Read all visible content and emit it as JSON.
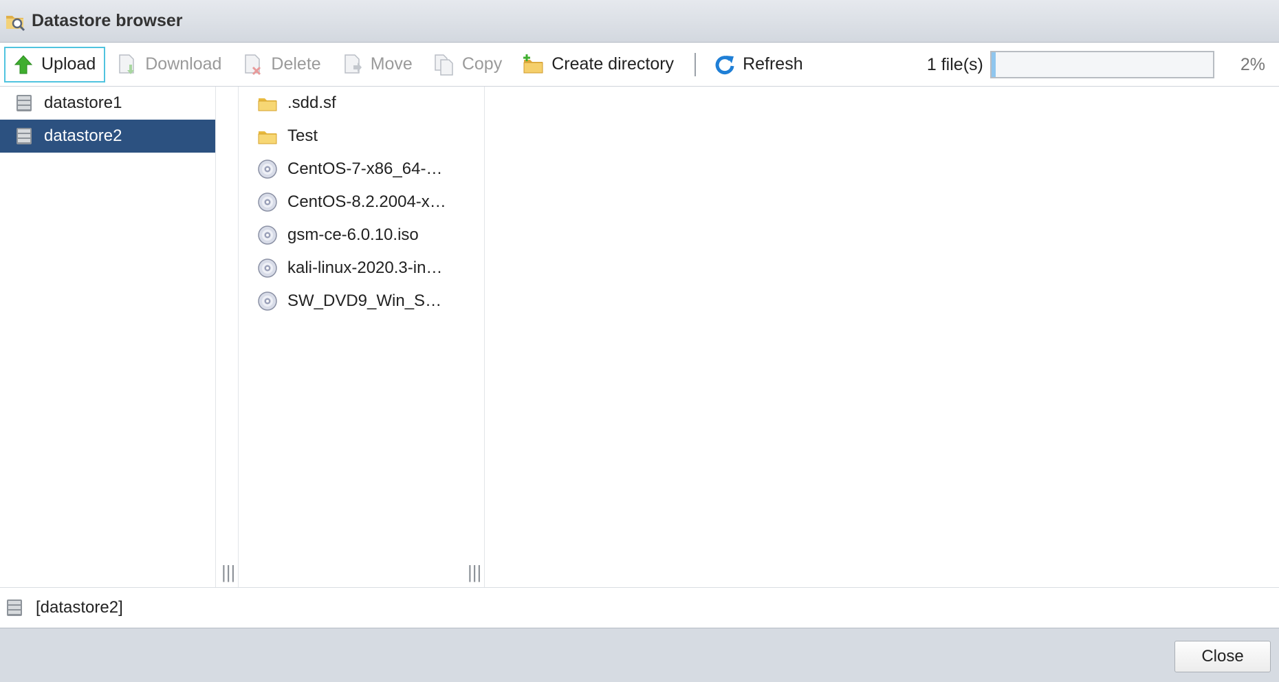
{
  "window": {
    "title": "Datastore browser",
    "icon": "datastore-browser-icon"
  },
  "toolbar": {
    "buttons": [
      {
        "label": "Upload",
        "icon": "upload-arrow-icon",
        "enabled": true
      },
      {
        "label": "Download",
        "icon": "download-icon",
        "enabled": false
      },
      {
        "label": "Delete",
        "icon": "delete-icon",
        "enabled": false
      },
      {
        "label": "Move",
        "icon": "move-icon",
        "enabled": false
      },
      {
        "label": "Copy",
        "icon": "copy-icon",
        "enabled": false
      },
      {
        "label": "Create directory",
        "icon": "create-folder-icon",
        "enabled": true
      },
      {
        "label": "Refresh",
        "icon": "refresh-icon",
        "enabled": true
      }
    ],
    "files_count": "1 file(s)",
    "progress_value": 0.02,
    "progress_text": "2%"
  },
  "datastores": [
    {
      "label": "datastore1",
      "selected": false
    },
    {
      "label": "datastore2",
      "selected": true
    }
  ],
  "files": [
    {
      "label": ".sdd.sf",
      "type": "folder"
    },
    {
      "label": "Test",
      "type": "folder"
    },
    {
      "label": "CentOS-7-x86_64-…",
      "type": "iso"
    },
    {
      "label": "CentOS-8.2.2004-x…",
      "type": "iso"
    },
    {
      "label": "gsm-ce-6.0.10.iso",
      "type": "iso"
    },
    {
      "label": "kali-linux-2020.3-in…",
      "type": "iso"
    },
    {
      "label": "SW_DVD9_Win_Sv…",
      "type": "iso"
    }
  ],
  "path": "[datastore2]",
  "footer": {
    "close_label": "Close"
  },
  "colors": {
    "selection": "#2c5180",
    "focus_border": "#4fc3df",
    "progress_fill": "#8fc6ee"
  }
}
